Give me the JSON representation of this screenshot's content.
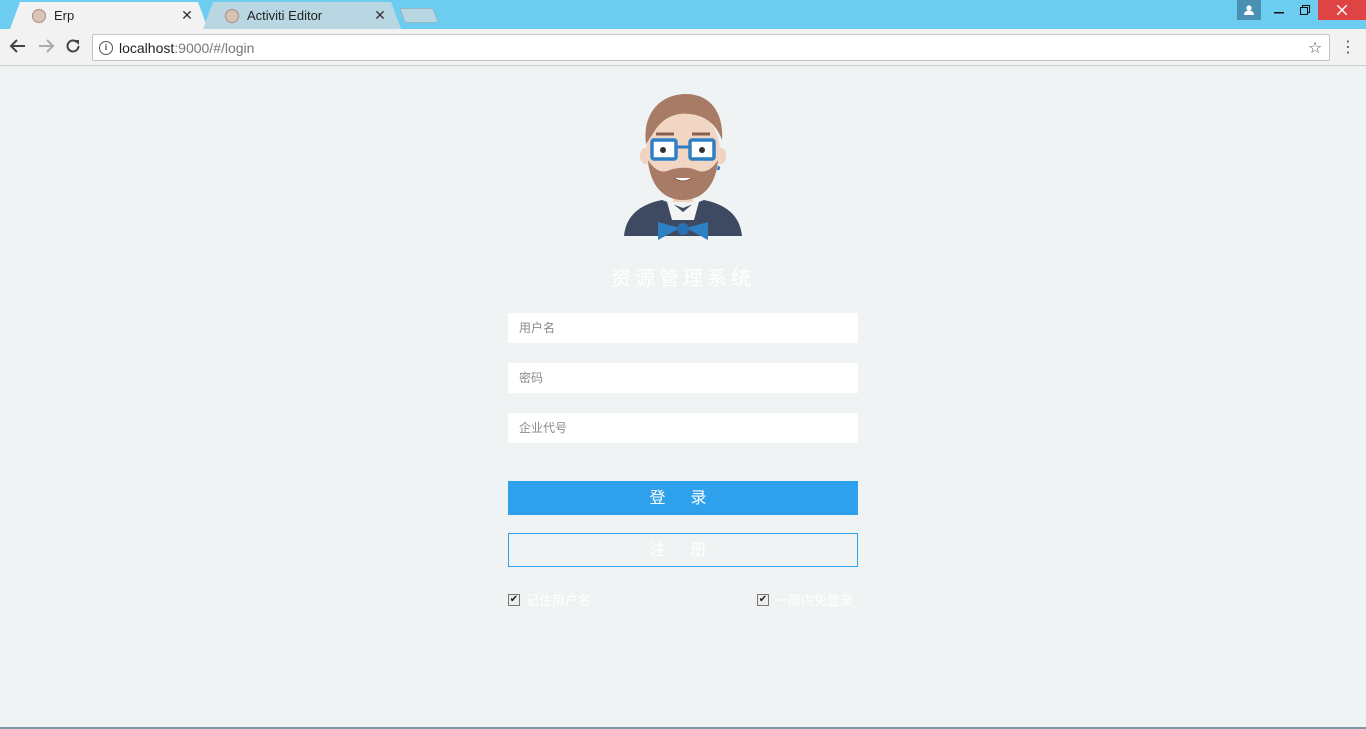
{
  "browser": {
    "tabs": [
      {
        "title": "Erp",
        "active": true
      },
      {
        "title": "Activiti Editor",
        "active": false
      }
    ],
    "close_glyph": "✕",
    "url_host": "localhost",
    "url_rest": ":9000/#/login"
  },
  "login": {
    "system_title": "资源管理系统",
    "username_placeholder": "用户名",
    "password_placeholder": "密码",
    "company_placeholder": "企业代号",
    "login_label": "登 录",
    "register_label": "注 册",
    "remember_username": "记住用户名",
    "remember_week": "一周内免登录"
  },
  "colors": {
    "primary": "#2ea0ec",
    "titlebar": "#6dcdf0",
    "background": "#f0f3f4"
  },
  "icons": [
    "back-arrow-icon",
    "forward-arrow-icon",
    "reload-icon",
    "info-icon",
    "star-icon",
    "menu-icon",
    "profile-icon",
    "minimize-icon",
    "maximize-icon",
    "close-icon",
    "avatar-illustration"
  ]
}
